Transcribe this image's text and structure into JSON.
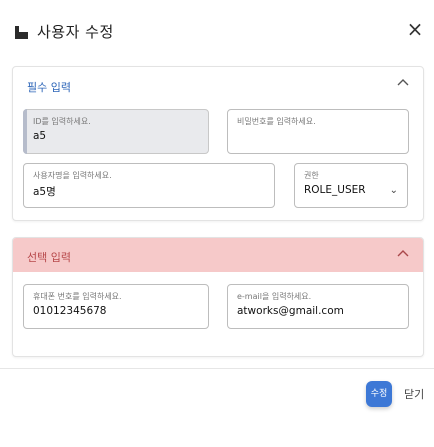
{
  "header": {
    "title": "사용자 수정",
    "close_symbol": "×",
    "icon": "user-edit-icon"
  },
  "section_basic": {
    "title": "필수 입력",
    "toggle_icon": "chevron-up-icon",
    "fields": {
      "user_id": {
        "label": "ID를 입력하세요.",
        "value": "a5"
      },
      "password": {
        "label": "비밀번호를 입력하세요.",
        "value": ""
      },
      "user_name": {
        "label": "사용자명을 입력하세요.",
        "value": "a5명"
      },
      "role": {
        "label": "권한",
        "value": "ROLE_USER",
        "arrow": "⌄"
      }
    }
  },
  "section_optional": {
    "title": "선택 입력",
    "toggle_icon": "chevron-up-icon",
    "fields": {
      "phone": {
        "label": "휴대폰 번호를 입력하세요.",
        "value": "01012345678"
      },
      "email": {
        "label": "e-mail을 입력하세요.",
        "value": "atworks@gmail.com"
      }
    }
  },
  "footer": {
    "edit_label": "수정",
    "close_label": "닫기"
  },
  "colors": {
    "accent": "#3d78d6",
    "section_basic_title": "#2e66b8",
    "section_optional_bg": "#f6c9c9",
    "section_optional_title": "#b7484a"
  }
}
